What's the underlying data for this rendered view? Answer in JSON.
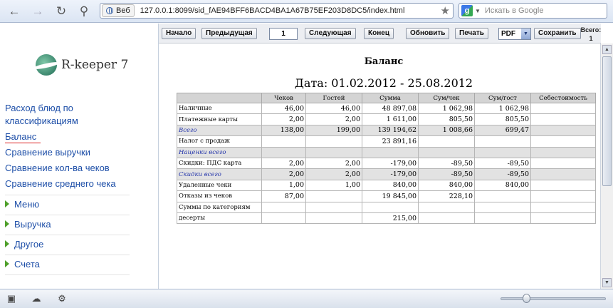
{
  "browser": {
    "back_icon": "back-arrow-icon",
    "forward_icon": "forward-arrow-icon",
    "reload_icon": "reload-icon",
    "key_icon": "key-icon",
    "address_chip": "Веб",
    "url": "127.0.0.1:8099/sid_fAE94BFF6BACD4BA1A67B75EF203D8DC5/index.html",
    "search_placeholder": "Искать в Google"
  },
  "sidebar": {
    "brand": "R-keeper 7",
    "links": [
      {
        "label": "Расход блюд по"
      },
      {
        "label": "классификациям"
      },
      {
        "label": "Баланс"
      },
      {
        "label": "Сравнение выручки"
      },
      {
        "label": "Сравнение кол-ва чеков"
      },
      {
        "label": "Сравнение среднего чека"
      }
    ],
    "menu": [
      {
        "label": "Меню"
      },
      {
        "label": "Выручка"
      },
      {
        "label": "Другое"
      },
      {
        "label": "Счета"
      }
    ]
  },
  "toolbar": {
    "first": "Начало",
    "prev": "Предыдущая",
    "page": "1",
    "next": "Следующая",
    "last": "Конец",
    "refresh": "Обновить",
    "print": "Печать",
    "format": "PDF",
    "save": "Сохранить",
    "totals_label": "Всего:",
    "totals_value": "1"
  },
  "report": {
    "title": "Баланс",
    "date_range": "Дата: 01.02.2012 - 25.08.2012",
    "columns": [
      "",
      "Чеков",
      "Гостей",
      "Сумма",
      "Сум/чек",
      "Сум/гост",
      "Себестоимость"
    ],
    "rows": [
      {
        "label": "Наличные",
        "cells": [
          "46,00",
          "46,00",
          "48 897,08",
          "1 062,98",
          "1 062,98",
          ""
        ],
        "style": ""
      },
      {
        "label": "Платежные карты",
        "cells": [
          "2,00",
          "2,00",
          "1 611,00",
          "805,50",
          "805,50",
          ""
        ],
        "style": ""
      },
      {
        "label": "Всего",
        "cells": [
          "138,00",
          "199,00",
          "139 194,62",
          "1 008,66",
          "699,47",
          ""
        ],
        "style": "grey ital"
      },
      {
        "label": "Налог с продаж",
        "cells": [
          "",
          "",
          "23 891,16",
          "",
          "",
          ""
        ],
        "style": ""
      },
      {
        "label": "Наценки всего",
        "cells": [
          "",
          "",
          "",
          "",
          "",
          ""
        ],
        "style": "grey ital"
      },
      {
        "label": "Скидки: ПДС карта",
        "cells": [
          "2,00",
          "2,00",
          "-179,00",
          "-89,50",
          "-89,50",
          ""
        ],
        "style": ""
      },
      {
        "label": "Скидки всего",
        "cells": [
          "2,00",
          "2,00",
          "-179,00",
          "-89,50",
          "-89,50",
          ""
        ],
        "style": "grey ital"
      },
      {
        "label": "Удаленные чеки",
        "cells": [
          "1,00",
          "1,00",
          "840,00",
          "840,00",
          "840,00",
          ""
        ],
        "style": ""
      },
      {
        "label": "Отказы из чеков",
        "cells": [
          "87,00",
          "",
          "19 845,00",
          "228,10",
          "",
          ""
        ],
        "style": ""
      },
      {
        "label": "Суммы по категориям",
        "cells": [
          "",
          "",
          "",
          "",
          "",
          ""
        ],
        "style": ""
      },
      {
        "label": "десерты",
        "cells": [
          "",
          "",
          "215,00",
          "",
          "",
          ""
        ],
        "style": ""
      }
    ]
  }
}
